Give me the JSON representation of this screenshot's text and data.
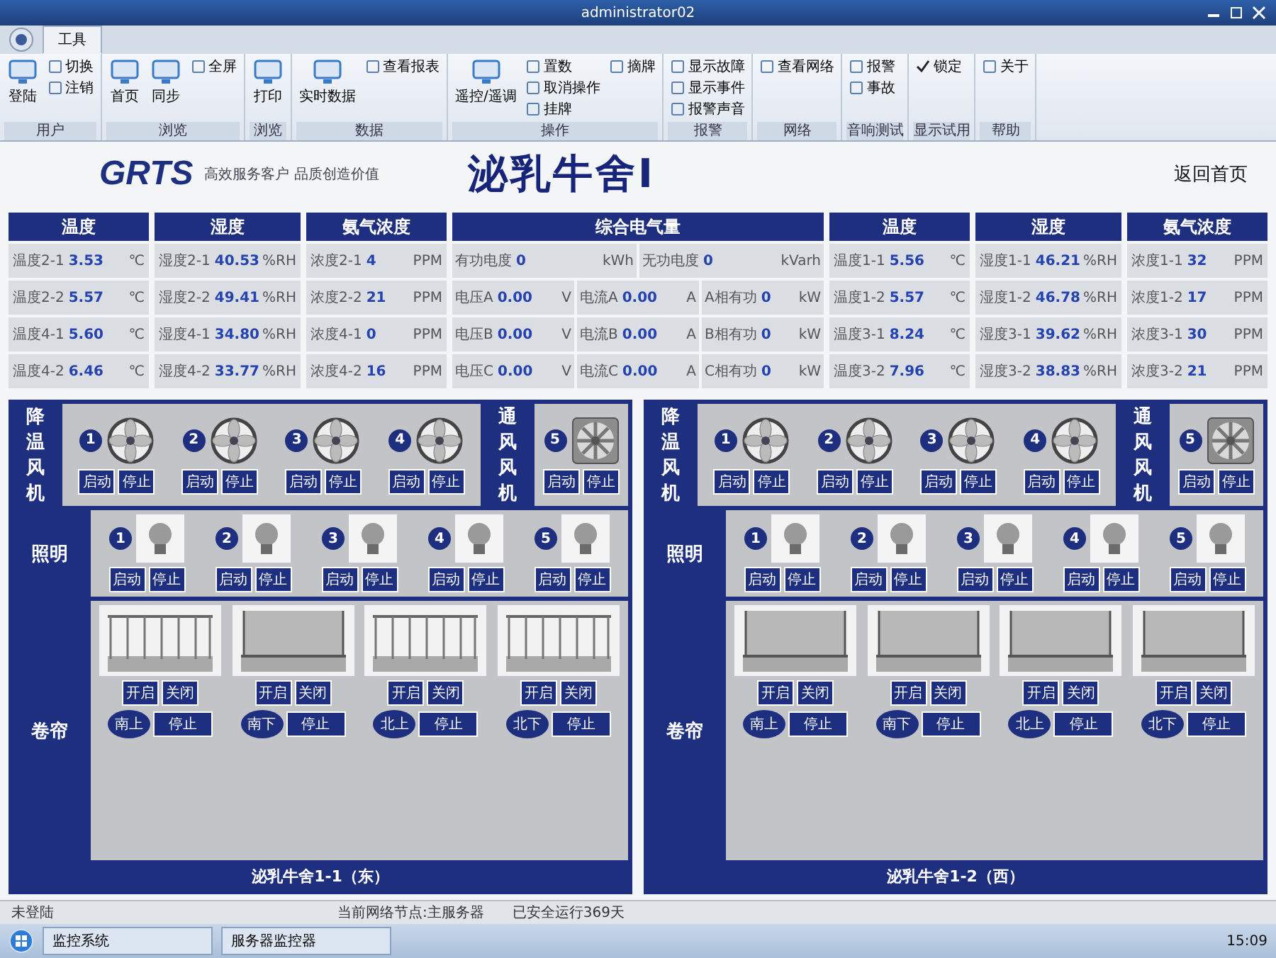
{
  "window": {
    "title": "administrator02"
  },
  "ribbon": {
    "tabs": [
      {
        "label": "工具",
        "selected": true
      }
    ],
    "groups": [
      {
        "label": "用户",
        "items": [
          {
            "kind": "large",
            "label": "登陆"
          },
          {
            "kind": "small",
            "label": "切换"
          },
          {
            "kind": "small",
            "label": "注销"
          }
        ]
      },
      {
        "label": "浏览",
        "items": [
          {
            "kind": "large",
            "label": "首页"
          },
          {
            "kind": "large",
            "label": "同步"
          },
          {
            "kind": "small",
            "label": "全屏"
          }
        ]
      },
      {
        "label": "浏览",
        "items": [
          {
            "kind": "large",
            "label": "打印"
          }
        ]
      },
      {
        "label": "数据",
        "items": [
          {
            "kind": "large",
            "label": "实时数据"
          },
          {
            "kind": "small",
            "label": "查看报表"
          }
        ]
      },
      {
        "label": "操作",
        "items": [
          {
            "kind": "large",
            "label": "遥控/遥调"
          },
          {
            "kind": "small",
            "label": "置数"
          },
          {
            "kind": "small",
            "label": "取消操作"
          },
          {
            "kind": "small",
            "label": "挂牌"
          },
          {
            "kind": "small",
            "label": "摘牌"
          }
        ]
      },
      {
        "label": "报警",
        "items": [
          {
            "kind": "small",
            "label": "显示故障"
          },
          {
            "kind": "small",
            "label": "显示事件"
          },
          {
            "kind": "small",
            "label": "报警声音"
          }
        ]
      },
      {
        "label": "网络",
        "items": [
          {
            "kind": "small",
            "label": "查看网络"
          }
        ]
      },
      {
        "label": "音响测试",
        "items": [
          {
            "kind": "small",
            "label": "报警"
          },
          {
            "kind": "small",
            "label": "事故"
          }
        ]
      },
      {
        "label": "显示试用",
        "items": [
          {
            "kind": "check",
            "label": "锁定",
            "checked": true
          }
        ]
      },
      {
        "label": "帮助",
        "items": [
          {
            "kind": "small",
            "label": "关于"
          }
        ]
      }
    ]
  },
  "header": {
    "logo": "GRTS",
    "slogan": "高效服务客户 品质创造价值",
    "title": "泌乳牛舍Ⅰ",
    "back_link": "返回首页"
  },
  "sensor_groups": [
    {
      "kind": "sensor",
      "title": "温度",
      "rows": [
        {
          "label": "温度2-1",
          "value": "3.53",
          "unit": "℃"
        },
        {
          "label": "温度2-2",
          "value": "5.57",
          "unit": "℃"
        },
        {
          "label": "温度4-1",
          "value": "5.60",
          "unit": "℃"
        },
        {
          "label": "温度4-2",
          "value": "6.46",
          "unit": "℃"
        }
      ]
    },
    {
      "kind": "sensor",
      "title": "湿度",
      "rows": [
        {
          "label": "湿度2-1",
          "value": "40.53",
          "unit": "%RH"
        },
        {
          "label": "湿度2-2",
          "value": "49.41",
          "unit": "%RH"
        },
        {
          "label": "湿度4-1",
          "value": "34.80",
          "unit": "%RH"
        },
        {
          "label": "湿度4-2",
          "value": "33.77",
          "unit": "%RH"
        }
      ]
    },
    {
      "kind": "sensor",
      "title": "氨气浓度",
      "rows": [
        {
          "label": "浓度2-1",
          "value": "4",
          "unit": "PPM"
        },
        {
          "label": "浓度2-2",
          "value": "21",
          "unit": "PPM"
        },
        {
          "label": "浓度4-1",
          "value": "0",
          "unit": "PPM"
        },
        {
          "label": "浓度4-2",
          "value": "16",
          "unit": "PPM"
        }
      ]
    },
    {
      "kind": "electric",
      "title": "综合电气量",
      "totals": [
        {
          "label": "有功电度",
          "value": "0",
          "unit": "kWh"
        },
        {
          "label": "无功电度",
          "value": "0",
          "unit": "kVarh"
        }
      ],
      "rows": [
        [
          {
            "label": "电压A",
            "value": "0.00",
            "unit": "V"
          },
          {
            "label": "电流A",
            "value": "0.00",
            "unit": "A"
          },
          {
            "label": "A相有功",
            "value": "0",
            "unit": "kW"
          }
        ],
        [
          {
            "label": "电压B",
            "value": "0.00",
            "unit": "V"
          },
          {
            "label": "电流B",
            "value": "0.00",
            "unit": "A"
          },
          {
            "label": "B相有功",
            "value": "0",
            "unit": "kW"
          }
        ],
        [
          {
            "label": "电压C",
            "value": "0.00",
            "unit": "V"
          },
          {
            "label": "电流C",
            "value": "0.00",
            "unit": "A"
          },
          {
            "label": "C相有功",
            "value": "0",
            "unit": "kW"
          }
        ]
      ]
    },
    {
      "kind": "sensor",
      "title": "温度",
      "rows": [
        {
          "label": "温度1-1",
          "value": "5.56",
          "unit": "℃"
        },
        {
          "label": "温度1-2",
          "value": "5.57",
          "unit": "℃"
        },
        {
          "label": "温度3-1",
          "value": "8.24",
          "unit": "℃"
        },
        {
          "label": "温度3-2",
          "value": "7.96",
          "unit": "℃"
        }
      ]
    },
    {
      "kind": "sensor",
      "title": "湿度",
      "rows": [
        {
          "label": "湿度1-1",
          "value": "46.21",
          "unit": "%RH"
        },
        {
          "label": "湿度1-2",
          "value": "46.78",
          "unit": "%RH"
        },
        {
          "label": "湿度3-1",
          "value": "39.62",
          "unit": "%RH"
        },
        {
          "label": "湿度3-2",
          "value": "38.83",
          "unit": "%RH"
        }
      ]
    },
    {
      "kind": "sensor",
      "title": "氨气浓度",
      "rows": [
        {
          "label": "浓度1-1",
          "value": "32",
          "unit": "PPM"
        },
        {
          "label": "浓度1-2",
          "value": "17",
          "unit": "PPM"
        },
        {
          "label": "浓度3-1",
          "value": "30",
          "unit": "PPM"
        },
        {
          "label": "浓度3-2",
          "value": "21",
          "unit": "PPM"
        }
      ]
    }
  ],
  "barns": [
    {
      "title": "泌乳牛舍1-1（东）",
      "cooling_label": "降温风机",
      "cooling_fans": [
        {
          "number": "1",
          "start": "启动",
          "stop": "停止"
        },
        {
          "number": "2",
          "start": "启动",
          "stop": "停止"
        },
        {
          "number": "3",
          "start": "启动",
          "stop": "停止"
        },
        {
          "number": "4",
          "start": "启动",
          "stop": "停止"
        }
      ],
      "vent_label": "通风风机",
      "vent_fans": [
        {
          "number": "5",
          "start": "启动",
          "stop": "停止"
        }
      ],
      "light_label": "照明",
      "lights": [
        {
          "number": "1",
          "start": "启动",
          "stop": "停止"
        },
        {
          "number": "2",
          "start": "启动",
          "stop": "停止"
        },
        {
          "number": "3",
          "start": "启动",
          "stop": "停止"
        },
        {
          "number": "4",
          "start": "启动",
          "stop": "停止"
        },
        {
          "number": "5",
          "start": "启动",
          "stop": "停止"
        }
      ],
      "curtain_label": "卷帘",
      "curtains": [
        {
          "closed": false,
          "open": "开启",
          "close": "关闭",
          "direction": "南上",
          "stop": "停止"
        },
        {
          "closed": true,
          "open": "开启",
          "close": "关闭",
          "direction": "南下",
          "stop": "停止"
        },
        {
          "closed": false,
          "open": "开启",
          "close": "关闭",
          "direction": "北上",
          "stop": "停止"
        },
        {
          "closed": false,
          "open": "开启",
          "close": "关闭",
          "direction": "北下",
          "stop": "停止"
        }
      ]
    },
    {
      "title": "泌乳牛舍1-2（西）",
      "cooling_label": "降温风机",
      "cooling_fans": [
        {
          "number": "1",
          "start": "启动",
          "stop": "停止"
        },
        {
          "number": "2",
          "start": "启动",
          "stop": "停止"
        },
        {
          "number": "3",
          "start": "启动",
          "stop": "停止"
        },
        {
          "number": "4",
          "start": "启动",
          "stop": "停止"
        }
      ],
      "vent_label": "通风风机",
      "vent_fans": [
        {
          "number": "5",
          "start": "启动",
          "stop": "停止"
        }
      ],
      "light_label": "照明",
      "lights": [
        {
          "number": "1",
          "start": "启动",
          "stop": "停止"
        },
        {
          "number": "2",
          "start": "启动",
          "stop": "停止"
        },
        {
          "number": "3",
          "start": "启动",
          "stop": "停止"
        },
        {
          "number": "4",
          "start": "启动",
          "stop": "停止"
        },
        {
          "number": "5",
          "start": "启动",
          "stop": "停止"
        }
      ],
      "curtain_label": "卷帘",
      "curtains": [
        {
          "closed": true,
          "open": "开启",
          "close": "关闭",
          "direction": "南上",
          "stop": "停止"
        },
        {
          "closed": true,
          "open": "开启",
          "close": "关闭",
          "direction": "南下",
          "stop": "停止"
        },
        {
          "closed": true,
          "open": "开启",
          "close": "关闭",
          "direction": "北上",
          "stop": "停止"
        },
        {
          "closed": true,
          "open": "开启",
          "close": "关闭",
          "direction": "北下",
          "stop": "停止"
        }
      ]
    }
  ],
  "status_bar": {
    "login": "未登陆",
    "items": [
      "当前网络节点:主服务器",
      "已安全运行369天"
    ]
  },
  "taskbar": {
    "items": [
      "监控系统",
      "服务器监控器"
    ],
    "clock": "15:09"
  }
}
